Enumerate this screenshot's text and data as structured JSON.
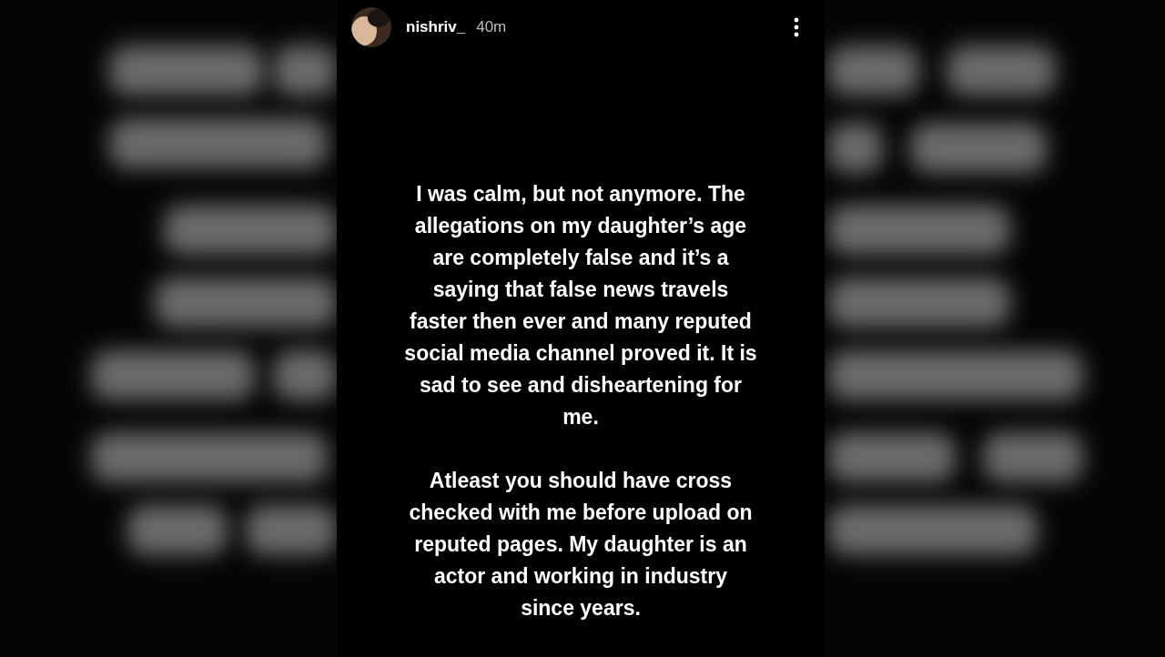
{
  "story": {
    "username": "nishriv_",
    "time": "40m",
    "paragraphs": [
      "I was calm, but not anymore. The\nallegations on my daughter’s age\nare completely false and it’s a\nsaying that false news travels\nfaster then ever and many reputed\nsocial media channel proved it. It is\nsad to see and disheartening for\nme.",
      "Atleast you should have cross\nchecked with me before upload on\nreputed pages. My daughter is an\nactor and working in industry\nsince years."
    ]
  }
}
